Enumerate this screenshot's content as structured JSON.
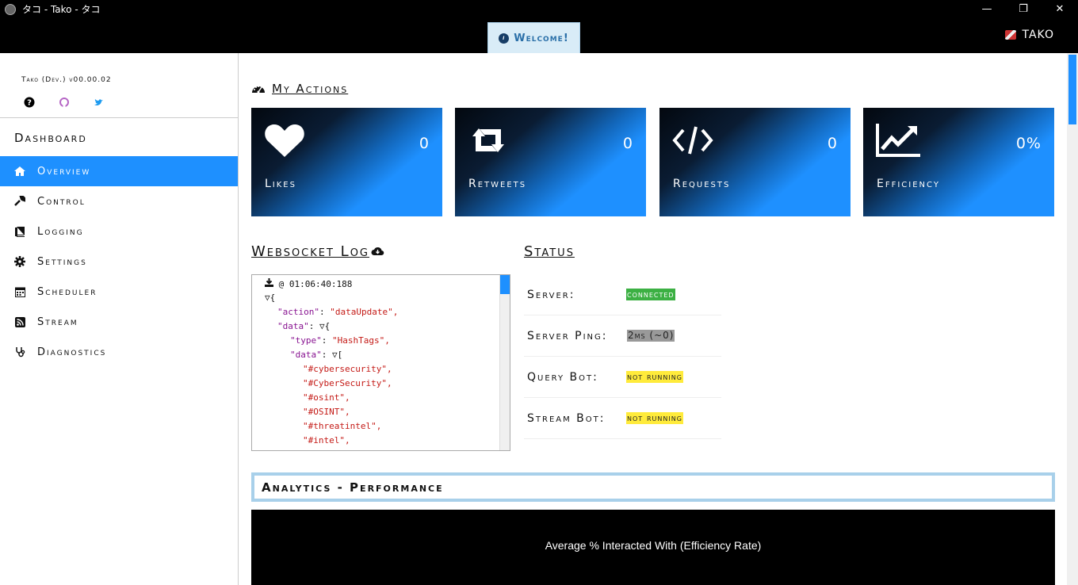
{
  "window": {
    "title": "タコ - Tako - タコ",
    "minimize": "—",
    "maximize": "❐",
    "close": "✕"
  },
  "header": {
    "welcome_label": "Welcome!",
    "user_name": "TAKO"
  },
  "sidebar": {
    "version": "Tako (Dev.) v00.00.02",
    "dashboard_title": "Dashboard",
    "items": [
      {
        "label": "Overview",
        "icon": "home-icon",
        "active": true
      },
      {
        "label": "Control",
        "icon": "wrench-icon"
      },
      {
        "label": "Logging",
        "icon": "book-icon"
      },
      {
        "label": "Settings",
        "icon": "gear-icon"
      },
      {
        "label": "Scheduler",
        "icon": "calendar-icon"
      },
      {
        "label": "Stream",
        "icon": "rss-icon"
      },
      {
        "label": "Diagnostics",
        "icon": "stethoscope-icon"
      }
    ]
  },
  "actions": {
    "heading": "My Actions",
    "cards": [
      {
        "label": "Likes",
        "value": "0",
        "icon": "heart-icon"
      },
      {
        "label": "Retweets",
        "value": "0",
        "icon": "retweet-icon"
      },
      {
        "label": "Requests",
        "value": "0",
        "icon": "code-icon"
      },
      {
        "label": "Efficiency",
        "value": "0%",
        "icon": "line-chart-icon"
      }
    ]
  },
  "websocket": {
    "heading": "Websocket Log",
    "timestamp": "@ 01:06:40:188",
    "lines": {
      "l1": "{",
      "l2k": "\"action\"",
      "l2v": "\"dataUpdate\",",
      "l3k": "\"data\"",
      "l3v": "{",
      "l4k": "\"type\"",
      "l4v": "\"HashTags\",",
      "l5k": "\"data\"",
      "l5v": "[",
      "l6": "\"#cybersecurity\",",
      "l7": "\"#CyberSecurity\",",
      "l8": "\"#osint\",",
      "l9": "\"#OSINT\",",
      "l10": "\"#threatintel\",",
      "l11": "\"#intel\","
    }
  },
  "status": {
    "heading": "Status",
    "rows": [
      {
        "label": "Server:",
        "value": "connected",
        "color": "#3cb043"
      },
      {
        "label": "Server Ping:",
        "value": "2ms (~0)",
        "color": "#999999"
      },
      {
        "label": "Query Bot:",
        "value": "not running",
        "color": "#ffeb3b"
      },
      {
        "label": "Stream Bot:",
        "value": "not running",
        "color": "#ffeb3b"
      }
    ]
  },
  "analytics": {
    "heading": "Analytics - Performance",
    "chart_title": "Average % Interacted With (Efficiency Rate)"
  },
  "colors": {
    "accent": "#1e90ff",
    "panel_border": "#a8d0ea"
  }
}
